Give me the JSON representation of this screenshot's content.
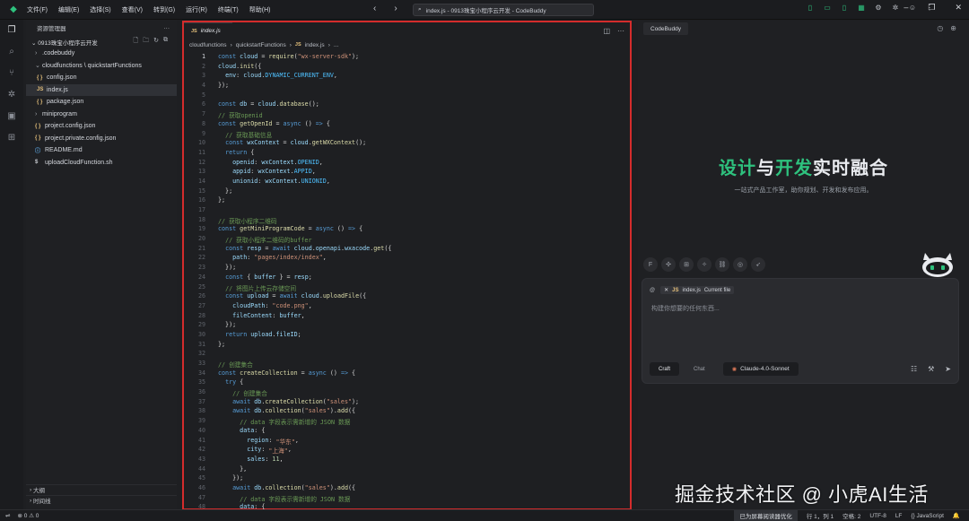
{
  "app": {
    "window_title": "index.js - 0913珠宝小程序云开发 - CodeBuddy",
    "menu": [
      "文件(F)",
      "编辑(E)",
      "选择(S)",
      "查看(V)",
      "转到(G)",
      "运行(R)",
      "终端(T)",
      "帮助(H)"
    ]
  },
  "sidebar": {
    "title": "资源管理器",
    "project": "0913珠宝小程序云开发",
    "tree": [
      {
        "label": ".codebuddy",
        "type": "folder",
        "depth": 1,
        "open": false
      },
      {
        "label": "cloudfunctions \\ quickstartFunctions",
        "type": "folder",
        "depth": 1,
        "open": true
      },
      {
        "label": "config.json",
        "type": "json",
        "depth": 2
      },
      {
        "label": "index.js",
        "type": "js",
        "depth": 2,
        "selected": true
      },
      {
        "label": "package.json",
        "type": "json",
        "depth": 2
      },
      {
        "label": "miniprogram",
        "type": "folder",
        "depth": 1,
        "open": false
      },
      {
        "label": "project.config.json",
        "type": "json",
        "depth": 1
      },
      {
        "label": "project.private.config.json",
        "type": "json",
        "depth": 1
      },
      {
        "label": "README.md",
        "type": "info",
        "depth": 1
      },
      {
        "label": "uploadCloudFunction.sh",
        "type": "sh",
        "depth": 1
      }
    ],
    "outline_label": "大纲",
    "timeline_label": "时间线"
  },
  "editor": {
    "tab_label": "index.js",
    "breadcrumb": [
      "cloudfunctions",
      "quickstartFunctions",
      "index.js",
      "..."
    ],
    "code": [
      [
        [
          "k",
          "const "
        ],
        [
          "v",
          "cloud"
        ],
        [
          "p",
          " = "
        ],
        [
          "f",
          "require"
        ],
        [
          "p",
          "("
        ],
        [
          "s",
          "\"wx-server-sdk\""
        ],
        [
          "p",
          ");"
        ]
      ],
      [
        [
          "v",
          "cloud"
        ],
        [
          "p",
          "."
        ],
        [
          "f",
          "init"
        ],
        [
          "p",
          "({"
        ]
      ],
      [
        [
          "p",
          "  "
        ],
        [
          "v",
          "env"
        ],
        [
          "p",
          ": "
        ],
        [
          "v",
          "cloud"
        ],
        [
          "p",
          "."
        ],
        [
          "cst",
          "DYNAMIC_CURRENT_ENV"
        ],
        [
          "p",
          ","
        ]
      ],
      [
        [
          "p",
          "});"
        ]
      ],
      [],
      [
        [
          "k",
          "const "
        ],
        [
          "v",
          "db"
        ],
        [
          "p",
          " = "
        ],
        [
          "v",
          "cloud"
        ],
        [
          "p",
          "."
        ],
        [
          "f",
          "database"
        ],
        [
          "p",
          "();"
        ]
      ],
      [
        [
          "c",
          "// 获取openid"
        ]
      ],
      [
        [
          "k",
          "const "
        ],
        [
          "f",
          "getOpenId"
        ],
        [
          "p",
          " = "
        ],
        [
          "k",
          "async "
        ],
        [
          "p",
          "() "
        ],
        [
          "k",
          "=>"
        ],
        [
          "p",
          " {"
        ]
      ],
      [
        [
          "p",
          "  "
        ],
        [
          "c",
          "// 获取基础信息"
        ]
      ],
      [
        [
          "p",
          "  "
        ],
        [
          "k",
          "const "
        ],
        [
          "v",
          "wxContext"
        ],
        [
          "p",
          " = "
        ],
        [
          "v",
          "cloud"
        ],
        [
          "p",
          "."
        ],
        [
          "f",
          "getWXContext"
        ],
        [
          "p",
          "();"
        ]
      ],
      [
        [
          "p",
          "  "
        ],
        [
          "k",
          "return "
        ],
        [
          "p",
          "{"
        ]
      ],
      [
        [
          "p",
          "    "
        ],
        [
          "v",
          "openid"
        ],
        [
          "p",
          ": "
        ],
        [
          "v",
          "wxContext"
        ],
        [
          "p",
          "."
        ],
        [
          "cst",
          "OPENID"
        ],
        [
          "p",
          ","
        ]
      ],
      [
        [
          "p",
          "    "
        ],
        [
          "v",
          "appid"
        ],
        [
          "p",
          ": "
        ],
        [
          "v",
          "wxContext"
        ],
        [
          "p",
          "."
        ],
        [
          "cst",
          "APPID"
        ],
        [
          "p",
          ","
        ]
      ],
      [
        [
          "p",
          "    "
        ],
        [
          "v",
          "unionid"
        ],
        [
          "p",
          ": "
        ],
        [
          "v",
          "wxContext"
        ],
        [
          "p",
          "."
        ],
        [
          "cst",
          "UNIONID"
        ],
        [
          "p",
          ","
        ]
      ],
      [
        [
          "p",
          "  };"
        ]
      ],
      [
        [
          "p",
          "};"
        ]
      ],
      [],
      [
        [
          "c",
          "// 获取小程序二维码"
        ]
      ],
      [
        [
          "k",
          "const "
        ],
        [
          "f",
          "getMiniProgramCode"
        ],
        [
          "p",
          " = "
        ],
        [
          "k",
          "async "
        ],
        [
          "p",
          "() "
        ],
        [
          "k",
          "=>"
        ],
        [
          "p",
          " {"
        ]
      ],
      [
        [
          "p",
          "  "
        ],
        [
          "c",
          "// 获取小程序二维码的buffer"
        ]
      ],
      [
        [
          "p",
          "  "
        ],
        [
          "k",
          "const "
        ],
        [
          "v",
          "resp"
        ],
        [
          "p",
          " = "
        ],
        [
          "k",
          "await "
        ],
        [
          "v",
          "cloud"
        ],
        [
          "p",
          "."
        ],
        [
          "v",
          "openapi"
        ],
        [
          "p",
          "."
        ],
        [
          "v",
          "wxacode"
        ],
        [
          "p",
          "."
        ],
        [
          "f",
          "get"
        ],
        [
          "p",
          "({"
        ]
      ],
      [
        [
          "p",
          "    "
        ],
        [
          "v",
          "path"
        ],
        [
          "p",
          ": "
        ],
        [
          "s",
          "\"pages/index/index\""
        ],
        [
          "p",
          ","
        ]
      ],
      [
        [
          "p",
          "  });"
        ]
      ],
      [
        [
          "p",
          "  "
        ],
        [
          "k",
          "const "
        ],
        [
          "p",
          "{ "
        ],
        [
          "v",
          "buffer"
        ],
        [
          "p",
          " } = "
        ],
        [
          "v",
          "resp"
        ],
        [
          "p",
          ";"
        ]
      ],
      [
        [
          "p",
          "  "
        ],
        [
          "c",
          "// 将图片上传云存储空间"
        ]
      ],
      [
        [
          "p",
          "  "
        ],
        [
          "k",
          "const "
        ],
        [
          "v",
          "upload"
        ],
        [
          "p",
          " = "
        ],
        [
          "k",
          "await "
        ],
        [
          "v",
          "cloud"
        ],
        [
          "p",
          "."
        ],
        [
          "f",
          "uploadFile"
        ],
        [
          "p",
          "({"
        ]
      ],
      [
        [
          "p",
          "    "
        ],
        [
          "v",
          "cloudPath"
        ],
        [
          "p",
          ": "
        ],
        [
          "s",
          "\"code.png\""
        ],
        [
          "p",
          ","
        ]
      ],
      [
        [
          "p",
          "    "
        ],
        [
          "v",
          "fileContent"
        ],
        [
          "p",
          ": "
        ],
        [
          "v",
          "buffer"
        ],
        [
          "p",
          ","
        ]
      ],
      [
        [
          "p",
          "  });"
        ]
      ],
      [
        [
          "p",
          "  "
        ],
        [
          "k",
          "return "
        ],
        [
          "v",
          "upload"
        ],
        [
          "p",
          "."
        ],
        [
          "v",
          "fileID"
        ],
        [
          "p",
          ";"
        ]
      ],
      [
        [
          "p",
          "};"
        ]
      ],
      [],
      [
        [
          "c",
          "// 创建集合"
        ]
      ],
      [
        [
          "k",
          "const "
        ],
        [
          "f",
          "createCollection"
        ],
        [
          "p",
          " = "
        ],
        [
          "k",
          "async "
        ],
        [
          "p",
          "() "
        ],
        [
          "k",
          "=>"
        ],
        [
          "p",
          " {"
        ]
      ],
      [
        [
          "p",
          "  "
        ],
        [
          "k",
          "try "
        ],
        [
          "p",
          "{"
        ]
      ],
      [
        [
          "p",
          "    "
        ],
        [
          "c",
          "// 创建集合"
        ]
      ],
      [
        [
          "p",
          "    "
        ],
        [
          "k",
          "await "
        ],
        [
          "v",
          "db"
        ],
        [
          "p",
          "."
        ],
        [
          "f",
          "createCollection"
        ],
        [
          "p",
          "("
        ],
        [
          "s",
          "\"sales\""
        ],
        [
          "p",
          ");"
        ]
      ],
      [
        [
          "p",
          "    "
        ],
        [
          "k",
          "await "
        ],
        [
          "v",
          "db"
        ],
        [
          "p",
          "."
        ],
        [
          "f",
          "collection"
        ],
        [
          "p",
          "("
        ],
        [
          "s",
          "\"sales\""
        ],
        [
          "p",
          ")."
        ],
        [
          "f",
          "add"
        ],
        [
          "p",
          "({"
        ]
      ],
      [
        [
          "p",
          "      "
        ],
        [
          "c",
          "// data 字段表示需新增的 JSON 数据"
        ]
      ],
      [
        [
          "p",
          "      "
        ],
        [
          "v",
          "data"
        ],
        [
          "p",
          ": {"
        ]
      ],
      [
        [
          "p",
          "        "
        ],
        [
          "v",
          "region"
        ],
        [
          "p",
          ": "
        ],
        [
          "s",
          "\"华东\""
        ],
        [
          "p",
          ","
        ]
      ],
      [
        [
          "p",
          "        "
        ],
        [
          "v",
          "city"
        ],
        [
          "p",
          ": "
        ],
        [
          "s",
          "\"上海\""
        ],
        [
          "p",
          ","
        ]
      ],
      [
        [
          "p",
          "        "
        ],
        [
          "v",
          "sales"
        ],
        [
          "p",
          ": "
        ],
        [
          "n",
          "11"
        ],
        [
          "p",
          ","
        ]
      ],
      [
        [
          "p",
          "      },"
        ]
      ],
      [
        [
          "p",
          "    });"
        ]
      ],
      [
        [
          "p",
          "    "
        ],
        [
          "k",
          "await "
        ],
        [
          "v",
          "db"
        ],
        [
          "p",
          "."
        ],
        [
          "f",
          "collection"
        ],
        [
          "p",
          "("
        ],
        [
          "s",
          "\"sales\""
        ],
        [
          "p",
          ")."
        ],
        [
          "f",
          "add"
        ],
        [
          "p",
          "({"
        ]
      ],
      [
        [
          "p",
          "      "
        ],
        [
          "c",
          "// data 字段表示需新增的 JSON 数据"
        ]
      ],
      [
        [
          "p",
          "      "
        ],
        [
          "v",
          "data"
        ],
        [
          "p",
          ": {"
        ]
      ]
    ],
    "line_numbers": [
      "1",
      "2",
      "3",
      "4",
      "5",
      "6",
      "7",
      "8",
      "9",
      "10",
      "11",
      "12",
      "13",
      "14",
      "15",
      "16",
      "17",
      "18",
      "19",
      "20",
      "21",
      "22",
      "23",
      "24",
      "25",
      "26",
      "27",
      "28",
      "29",
      "30",
      "31",
      "32",
      "33",
      "34",
      "35",
      "36",
      "37",
      "38",
      "39",
      "40",
      "41",
      "42",
      "43",
      "44",
      "45",
      "46",
      "47",
      "48"
    ]
  },
  "assistant": {
    "tab_label": "CodeBuddy",
    "hero_title_parts": [
      {
        "text": "设计",
        "color": "#2ec27e"
      },
      {
        "text": "与",
        "color": "#e9ebef"
      },
      {
        "text": "开发",
        "color": "#2ec27e"
      },
      {
        "text": "实时融合",
        "color": "#e9ebef"
      }
    ],
    "hero_subtitle": "一站式产品工作室，助你规划、开发和发布应用。",
    "context_file": "index.js",
    "context_note": "Current file",
    "input_placeholder": "构建你想要的任何东西...",
    "mode_craft": "Craft",
    "mode_chat": "Chat",
    "model_name": "Claude-4.0-Sonnet"
  },
  "statusbar": {
    "problems": "⊗ 0 ⚠ 0",
    "screen_reader": "已为屏幕阅读器优化",
    "cursor": "行 1，列 1",
    "spaces": "空格: 2",
    "encoding": "UTF-8",
    "eol": "LF",
    "language": "{} JavaScript"
  },
  "watermark": "掘金技术社区 @ 小虎AI生活"
}
